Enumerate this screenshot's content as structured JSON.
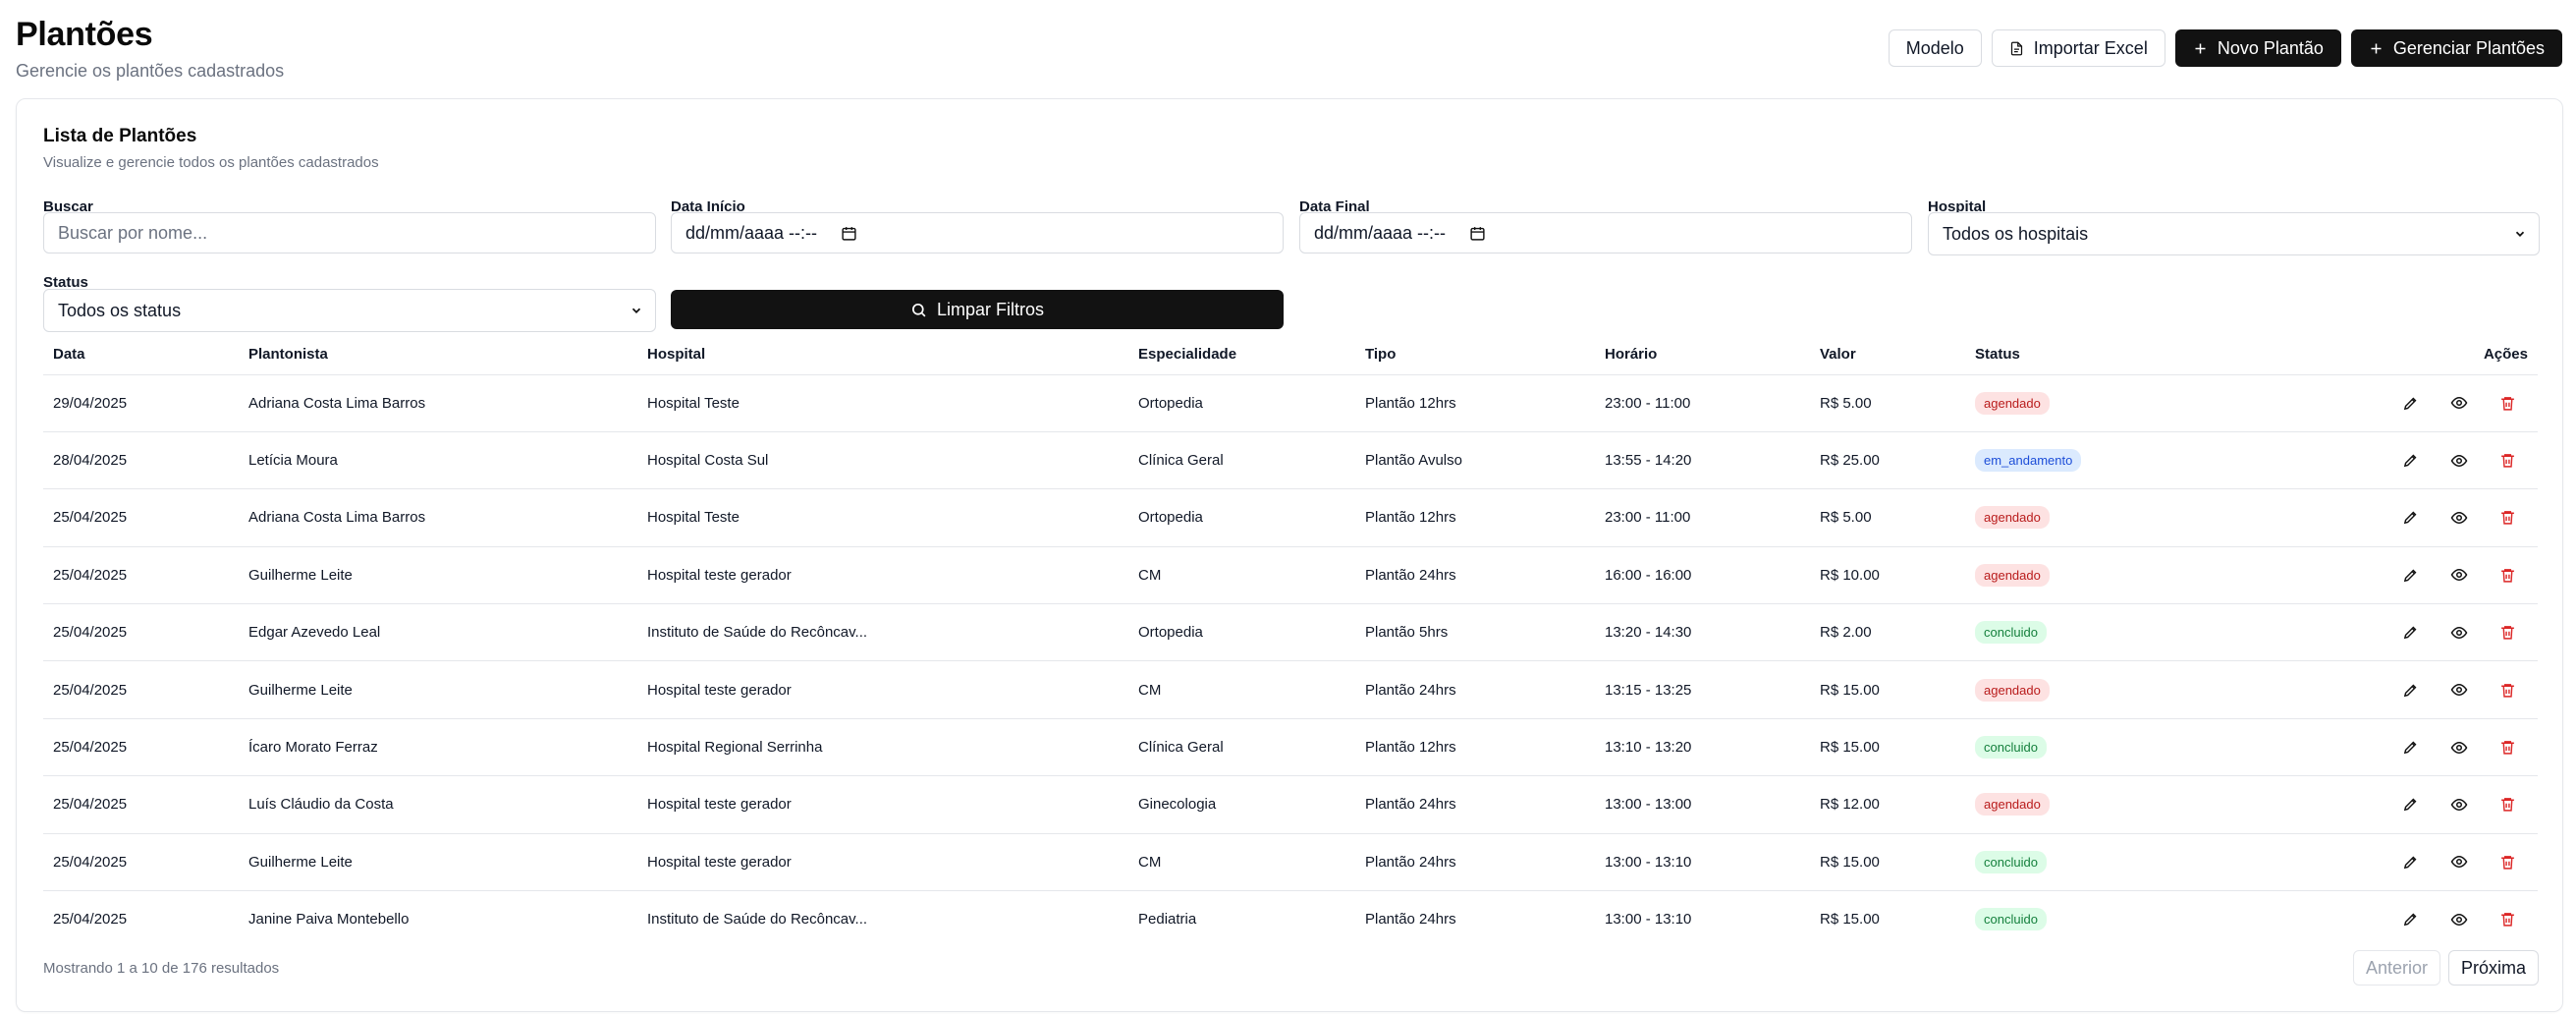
{
  "page": {
    "title": "Plantões",
    "subtitle": "Gerencie os plantões cadastrados"
  },
  "toolbar": {
    "modelo_label": "Modelo",
    "importar_label": "Importar Excel",
    "novo_label": "Novo Plantão",
    "gerenciar_label": "Gerenciar Plantões"
  },
  "card": {
    "title": "Lista de Plantões",
    "subtitle": "Visualize e gerencie todos os plantões cadastrados"
  },
  "filters": {
    "buscar_label": "Buscar",
    "buscar_placeholder": "Buscar por nome...",
    "data_inicio_label": "Data Início",
    "data_inicio_value": "dd/mm/aaaa --:--",
    "data_final_label": "Data Final",
    "data_final_value": "dd/mm/aaaa --:--",
    "hospital_label": "Hospital",
    "hospital_value": "Todos os hospitais",
    "status_label": "Status",
    "status_value": "Todos os status",
    "clear_label": "Limpar Filtros"
  },
  "table": {
    "headers": [
      "Data",
      "Plantonista",
      "Hospital",
      "Especialidade",
      "Tipo",
      "Horário",
      "Valor",
      "Status",
      "Ações"
    ],
    "rows": [
      {
        "data": "29/04/2025",
        "plantonista": "Adriana Costa Lima Barros",
        "hospital": "Hospital Teste",
        "especialidade": "Ortopedia",
        "tipo": "Plantão 12hrs",
        "horario": "23:00 - 11:00",
        "valor": "R$ 5.00",
        "status": "agendado"
      },
      {
        "data": "28/04/2025",
        "plantonista": "Letícia Moura",
        "hospital": "Hospital Costa Sul",
        "especialidade": "Clínica Geral",
        "tipo": "Plantão Avulso",
        "horario": "13:55 - 14:20",
        "valor": "R$ 25.00",
        "status": "em_andamento"
      },
      {
        "data": "25/04/2025",
        "plantonista": "Adriana Costa Lima Barros",
        "hospital": "Hospital Teste",
        "especialidade": "Ortopedia",
        "tipo": "Plantão 12hrs",
        "horario": "23:00 - 11:00",
        "valor": "R$ 5.00",
        "status": "agendado"
      },
      {
        "data": "25/04/2025",
        "plantonista": "Guilherme Leite",
        "hospital": "Hospital teste gerador",
        "especialidade": "CM",
        "tipo": "Plantão 24hrs",
        "horario": "16:00 - 16:00",
        "valor": "R$ 10.00",
        "status": "agendado"
      },
      {
        "data": "25/04/2025",
        "plantonista": "Edgar Azevedo Leal",
        "hospital": "Instituto de Saúde do Recôncav...",
        "especialidade": "Ortopedia",
        "tipo": "Plantão 5hrs",
        "horario": "13:20 - 14:30",
        "valor": "R$ 2.00",
        "status": "concluido"
      },
      {
        "data": "25/04/2025",
        "plantonista": "Guilherme Leite",
        "hospital": "Hospital teste gerador",
        "especialidade": "CM",
        "tipo": "Plantão 24hrs",
        "horario": "13:15 - 13:25",
        "valor": "R$ 15.00",
        "status": "agendado"
      },
      {
        "data": "25/04/2025",
        "plantonista": "Ícaro Morato Ferraz",
        "hospital": "Hospital Regional Serrinha",
        "especialidade": "Clínica Geral",
        "tipo": "Plantão 12hrs",
        "horario": "13:10 - 13:20",
        "valor": "R$ 15.00",
        "status": "concluido"
      },
      {
        "data": "25/04/2025",
        "plantonista": "Luís Cláudio da Costa",
        "hospital": "Hospital teste gerador",
        "especialidade": "Ginecologia",
        "tipo": "Plantão 24hrs",
        "horario": "13:00 - 13:00",
        "valor": "R$ 12.00",
        "status": "agendado"
      },
      {
        "data": "25/04/2025",
        "plantonista": "Guilherme Leite",
        "hospital": "Hospital teste gerador",
        "especialidade": "CM",
        "tipo": "Plantão 24hrs",
        "horario": "13:00 - 13:10",
        "valor": "R$ 15.00",
        "status": "concluido"
      },
      {
        "data": "25/04/2025",
        "plantonista": "Janine Paiva Montebello",
        "hospital": "Instituto de Saúde do Recôncav...",
        "especialidade": "Pediatria",
        "tipo": "Plantão 24hrs",
        "horario": "13:00 - 13:10",
        "valor": "R$ 15.00",
        "status": "concluido"
      }
    ]
  },
  "status_colors": {
    "agendado": "#fde2e2",
    "em_andamento": "#dbeafe",
    "concluido": "#dcfce7"
  },
  "icons": {
    "row_actions": [
      "pencil-icon",
      "eye-icon",
      "trash-icon"
    ]
  },
  "pagination": {
    "summary": "Mostrando 1 a 10 de 176 resultados",
    "prev_label": "Anterior",
    "next_label": "Próxima"
  }
}
